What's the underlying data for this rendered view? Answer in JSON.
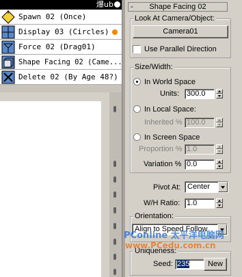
{
  "particle_view": {
    "header_title": "爆ub",
    "operators": [
      {
        "label": "Spawn 02 (Once)",
        "icon": "spawn-diamond-icon"
      },
      {
        "label": "Display 03 (Circles)",
        "icon": "display-icon",
        "badge_color": "#f08a00"
      },
      {
        "label": "Force 02 (Drag01)",
        "icon": "force-icon"
      },
      {
        "label": "Shape Facing 02 (Came...",
        "icon": "shape-facing-icon",
        "selected": true
      },
      {
        "label": "Delete 02 (By Age 48?)",
        "icon": "delete-icon"
      }
    ]
  },
  "rollout": {
    "title": "Shape Facing 02",
    "collapse_symbol": "-",
    "look_at": {
      "group_title": "Look At Camera/Object:",
      "camera_button": "Camera01",
      "use_parallel_label": "Use Parallel Direction",
      "use_parallel_checked": false
    },
    "size_width": {
      "group_title": "Size/Width:",
      "in_world_space_label": "In World Space",
      "units_label": "Units:",
      "units_value": "300.0",
      "in_local_space_label": "In Local Space:",
      "inherited_label": "Inherited %",
      "inherited_value": "100.0",
      "in_screen_space_label": "In Screen Space",
      "proportion_label": "Proportion %",
      "proportion_value": "1.0",
      "variation_label": "Variation %",
      "variation_value": "0.0",
      "selected_mode": "In World Space"
    },
    "pivot_at_label": "Pivot At:",
    "pivot_at_value": "Center",
    "wh_ratio_label": "W/H Ratio:",
    "wh_ratio_value": "1.0",
    "orientation": {
      "group_title": "Orientation:",
      "value": "Align to Speed Follow"
    },
    "uniqueness": {
      "group_title": "Uniqueness:",
      "seed_label": "Seed:",
      "seed_value": "235",
      "new_button": "New"
    }
  },
  "watermark": {
    "line1": "PConline 太平洋电脑网",
    "line2": "www.PCedu.com.cn"
  }
}
